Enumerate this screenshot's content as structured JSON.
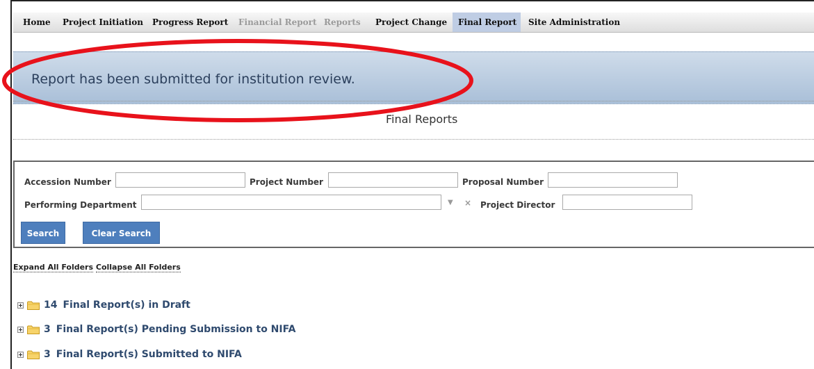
{
  "nav": {
    "items": [
      {
        "label": "Home",
        "state": "normal"
      },
      {
        "label": "Project Initiation",
        "state": "normal"
      },
      {
        "label": "Progress Report",
        "state": "normal"
      },
      {
        "label": "Financial Report",
        "state": "disabled"
      },
      {
        "label": "Reports",
        "state": "disabled"
      },
      {
        "label": "Project Change",
        "state": "normal"
      },
      {
        "label": "Final Report",
        "state": "active"
      },
      {
        "label": "Site Administration",
        "state": "normal"
      }
    ]
  },
  "banner": {
    "message": "Report has been submitted for institution review.",
    "highlight_color": "#e8121b"
  },
  "page": {
    "title": "Final Reports"
  },
  "search": {
    "accession_label": "Accession Number",
    "accession_value": "",
    "project_number_label": "Project Number",
    "project_number_value": "",
    "proposal_number_label": "Proposal Number",
    "proposal_number_value": "",
    "performing_department_label": "Performing Department",
    "performing_department_value": "",
    "project_director_label": "Project Director",
    "project_director_value": "",
    "search_button": "Search",
    "clear_button": "Clear Search"
  },
  "folders_controls": {
    "expand_all": "Expand All Folders",
    "collapse_all": "Collapse All Folders"
  },
  "folders": [
    {
      "count": "14",
      "label": "Final Report(s) in Draft"
    },
    {
      "count": "3",
      "label": "Final Report(s) Pending Submission to NIFA"
    },
    {
      "count": "3",
      "label": "Final Report(s) Submitted to NIFA"
    }
  ],
  "colors": {
    "accent_button": "#4e7fbd",
    "active_tab": "#bfcde4",
    "folder_text": "#2f4a6e"
  }
}
